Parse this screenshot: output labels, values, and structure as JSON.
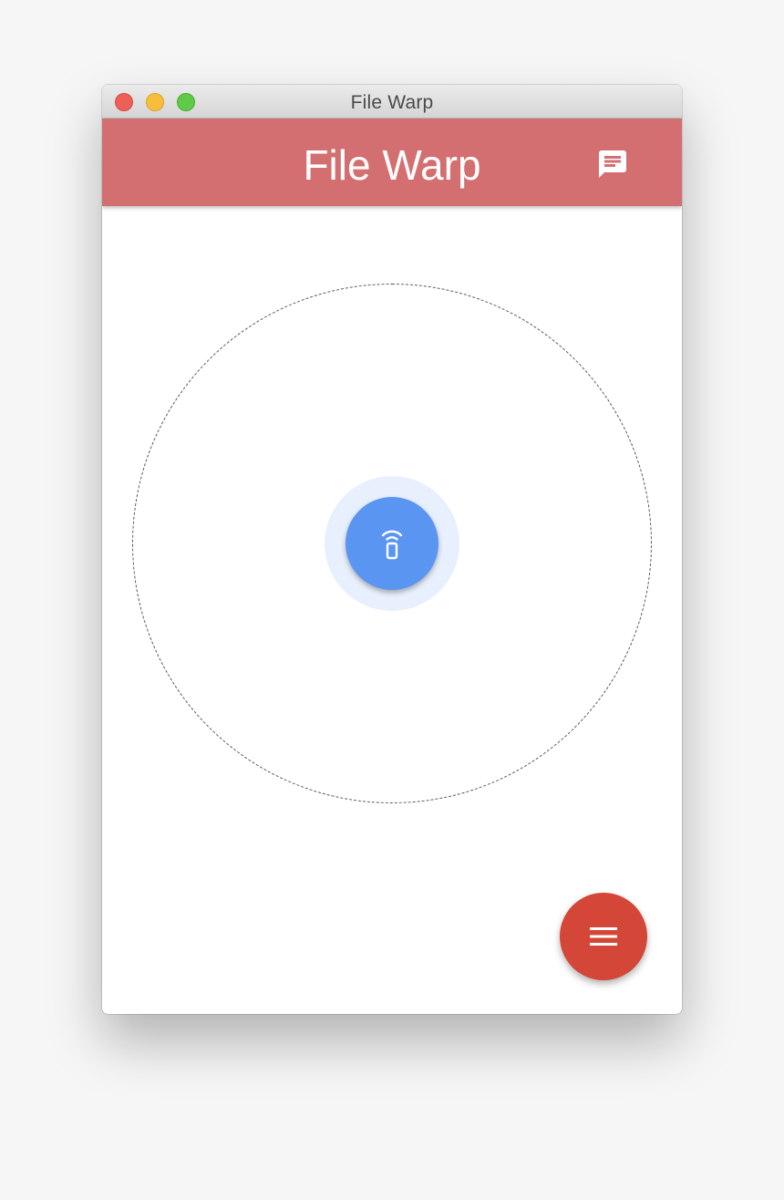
{
  "window": {
    "title": "File Warp",
    "controls": {
      "close": "close-button",
      "minimize": "minimize-button",
      "zoom": "zoom-button"
    }
  },
  "appbar": {
    "title": "File Warp",
    "background_color": "#d46f71",
    "chat_icon": "chat-icon"
  },
  "main": {
    "center_device_icon": "phone-signal-icon",
    "center_button_color": "#5b95f2",
    "menu_fab_icon": "menu-icon",
    "menu_fab_color": "#d44637"
  }
}
